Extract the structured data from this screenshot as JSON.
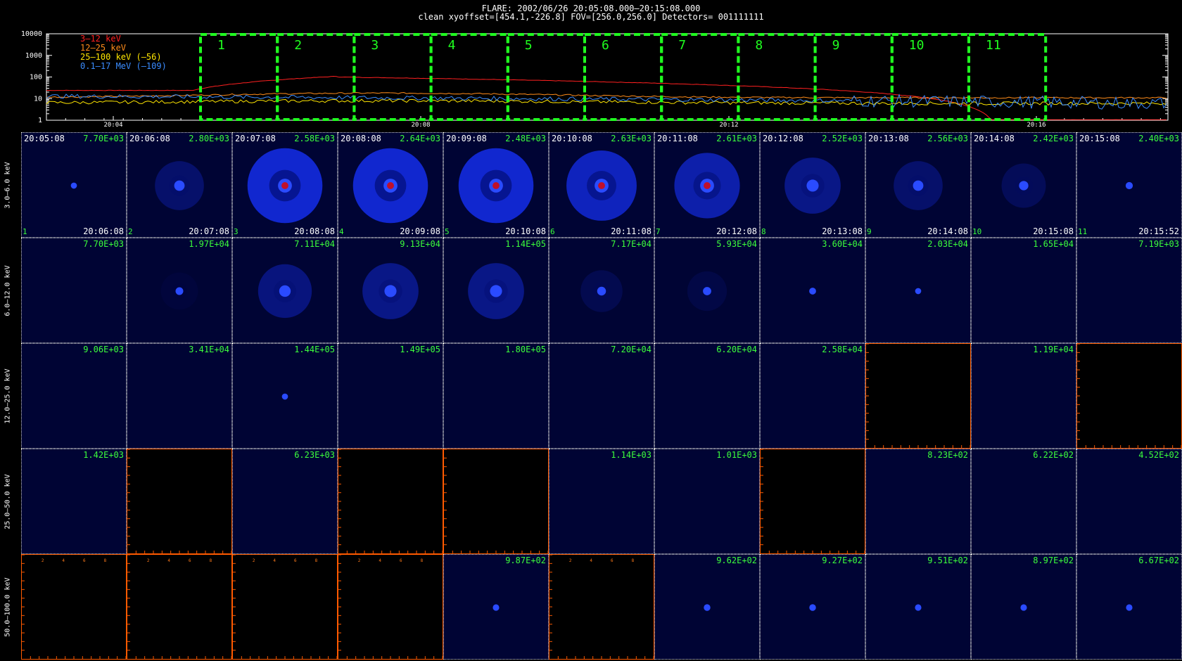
{
  "header": {
    "line1": "FLARE: 2002/06/26 20:05:08.000—20:15:08.000",
    "line2": "clean    xyoffset=[454.1,-226.8]    FOV=[256.0,256.0]    Detectors= 001111111"
  },
  "chart_data": [
    {
      "type": "line",
      "yscale": "log",
      "ylim": [
        1,
        10000
      ],
      "y_tick_labels": [
        "10000",
        "1000",
        "100",
        "10",
        "1"
      ],
      "x_tick_labels": [
        "20:04",
        "20:08",
        "20:12",
        "20:16"
      ],
      "legend": [
        {
          "label": "3—12 keV",
          "color": "#ff2020"
        },
        {
          "label": "12—25 keV",
          "color": "#ff8c1a"
        },
        {
          "label": "25—100 keV (—56)",
          "color": "#ffe600"
        },
        {
          "label": "0.1—17 MeV (—109)",
          "color": "#3a8cff"
        }
      ],
      "intervals": [
        "1",
        "2",
        "3",
        "4",
        "5",
        "6",
        "7",
        "8",
        "9",
        "10",
        "11"
      ],
      "interval_color": "#1fff1f"
    },
    {
      "type": "heatmap",
      "row_labels": [
        "3.0—6.0 keV",
        "6.0—12.0 keV",
        "12.0—25.0 keV",
        "25.0—50.0 keV",
        "50.0—100.0 keV"
      ],
      "start_times": [
        "20:05:08",
        "20:06:08",
        "20:07:08",
        "20:08:08",
        "20:09:08",
        "20:10:08",
        "20:11:08",
        "20:12:08",
        "20:13:08",
        "20:14:08",
        "20:15:08"
      ],
      "end_times": [
        "20:06:08",
        "20:07:08",
        "20:08:08",
        "20:09:08",
        "20:10:08",
        "20:11:08",
        "20:12:08",
        "20:13:08",
        "20:14:08",
        "20:15:08",
        "20:15:52"
      ],
      "interval_numbers": [
        "1",
        "2",
        "3",
        "4",
        "5",
        "6",
        "7",
        "8",
        "9",
        "10",
        "11"
      ],
      "flux": [
        [
          "7.70E+03",
          "2.80E+03",
          "2.58E+03",
          "2.64E+03",
          "2.48E+03",
          "2.63E+03",
          "2.61E+03",
          "2.52E+03",
          "2.56E+03",
          "2.42E+03",
          "2.40E+03"
        ],
        [
          "7.70E+03",
          "1.97E+04",
          "7.11E+04",
          "9.13E+04",
          "1.14E+05",
          "7.17E+04",
          "5.93E+04",
          "3.60E+04",
          "2.03E+04",
          "1.65E+04",
          "7.19E+03"
        ],
        [
          "9.06E+03",
          "3.41E+04",
          "1.44E+05",
          "1.49E+05",
          "1.80E+05",
          "7.20E+04",
          "6.20E+04",
          "2.58E+04",
          "",
          "1.19E+04",
          ""
        ],
        [
          "1.42E+03",
          "",
          "6.23E+03",
          "",
          "",
          "1.14E+03",
          "1.01E+03",
          "",
          "8.23E+02",
          "6.22E+02",
          "4.52E+02"
        ],
        [
          "",
          "",
          "",
          "",
          "9.87E+02",
          "",
          "9.62E+02",
          "9.27E+02",
          "9.51E+02",
          "8.97E+02",
          "6.67E+02"
        ]
      ],
      "source_level": [
        [
          0.05,
          0.45,
          1.0,
          1.0,
          1.0,
          0.9,
          0.8,
          0.6,
          0.45,
          0.35,
          0.15
        ],
        [
          0.0,
          0.2,
          0.55,
          0.6,
          0.6,
          0.3,
          0.25,
          0.12,
          0.05,
          0.0,
          0.0
        ],
        [
          0.0,
          0.0,
          0.05,
          0.0,
          0.0,
          0.0,
          0.0,
          0.0,
          0,
          0.0,
          0
        ],
        [
          0.0,
          0,
          0.0,
          0,
          0,
          0.0,
          0.0,
          0,
          0.0,
          0.0,
          0.0
        ],
        [
          0,
          0,
          0,
          0,
          0.08,
          0,
          0.1,
          0.1,
          0.08,
          0.08,
          0.08
        ]
      ],
      "empty_axis_labels": [
        "2",
        "4",
        "6",
        "8"
      ]
    }
  ]
}
